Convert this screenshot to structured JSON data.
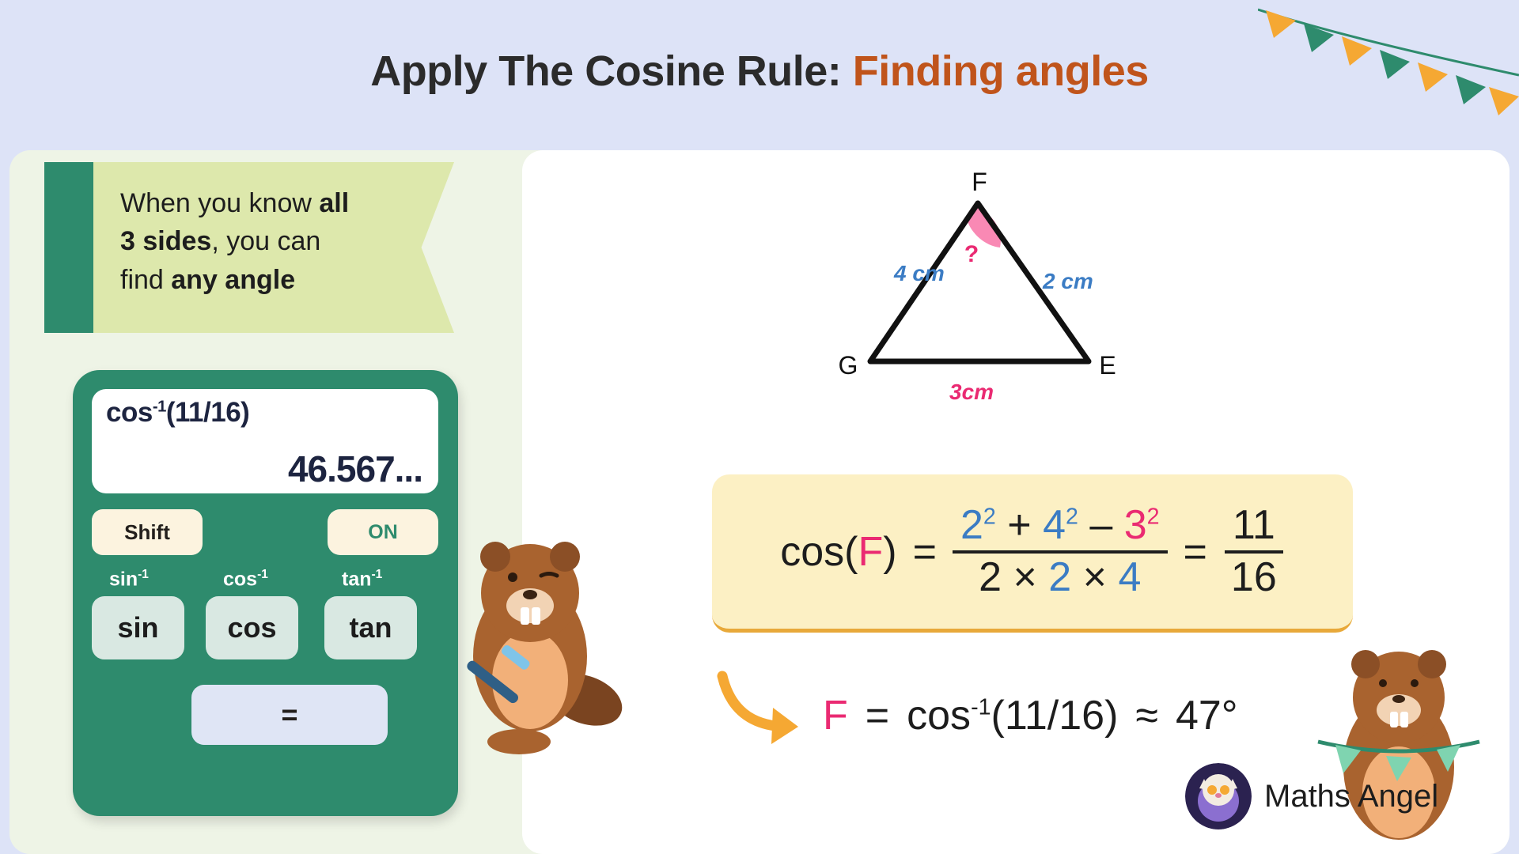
{
  "title": {
    "main": "Apply The Cosine Rule: ",
    "accent": "Finding angles"
  },
  "callout": {
    "line1_pre": "When you know ",
    "line1_bold": "all",
    "line2_bold": "3 sides",
    "line2_post": ", you can",
    "line3_pre": "find ",
    "line3_bold": "any angle"
  },
  "calculator": {
    "expression_base": "cos",
    "expression_sup": "-1",
    "expression_arg": "(11/16)",
    "result": "46.567...",
    "keys": {
      "shift": "Shift",
      "on": "ON",
      "sin_inv_base": "sin",
      "sin_inv_sup": "-1",
      "cos_inv_base": "cos",
      "cos_inv_sup": "-1",
      "tan_inv_base": "tan",
      "tan_inv_sup": "-1",
      "sin": "sin",
      "cos": "cos",
      "tan": "tan",
      "equals": "="
    }
  },
  "triangle": {
    "vertex_top": "F",
    "vertex_left": "G",
    "vertex_right": "E",
    "side_left": "4 cm",
    "side_right": "2 cm",
    "side_bottom": "3cm",
    "angle_marker": "?",
    "colors": {
      "side_blue": "#3b7cc4",
      "side_pink": "#ea2a72",
      "angle_fill": "#f989b4"
    }
  },
  "formula": {
    "lhs_cos": "cos(",
    "lhs_var": "F",
    "lhs_close": ")",
    "equals1": "=",
    "num_a": "2",
    "num_a_sup": "2",
    "plus": "+",
    "num_b": "4",
    "num_b_sup": "2",
    "minus": "–",
    "num_c": "3",
    "num_c_sup": "2",
    "den_2": "2",
    "times1": "×",
    "den_b": "2",
    "times2": "×",
    "den_c": "4",
    "equals2": "=",
    "result_num": "11",
    "result_den": "16"
  },
  "answer": {
    "var": "F",
    "equals": "=",
    "fn_base": "cos",
    "fn_sup": "-1",
    "fn_arg": "(11/16)",
    "approx": "≈",
    "value": "47°"
  },
  "brand": {
    "name": "Maths Angel"
  },
  "colors": {
    "background": "#dde3f7",
    "accent_orange": "#c0541b",
    "green": "#2e8b6d",
    "callout_green": "#dde8ac",
    "formula_yellow": "#fcf0c4",
    "arrow_orange": "#f5a833"
  }
}
